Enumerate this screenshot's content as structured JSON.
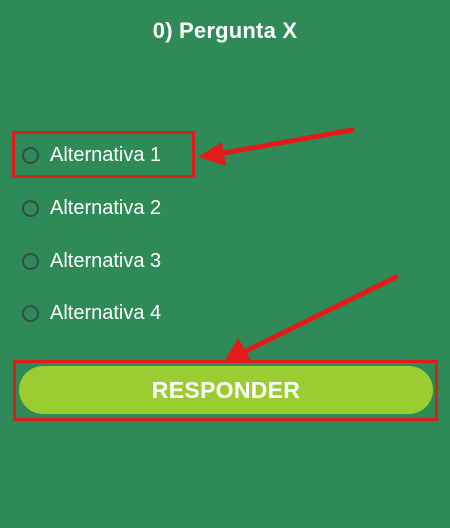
{
  "question": {
    "title": "0) Pergunta X"
  },
  "options": [
    {
      "label": "Alternativa 1"
    },
    {
      "label": "Alternativa 2"
    },
    {
      "label": "Alternativa 3"
    },
    {
      "label": "Alternativa 4"
    }
  ],
  "submit": {
    "label": "RESPONDER"
  },
  "annotations": {
    "color": "#e21b1b",
    "icons": [
      "arrow-icon",
      "arrow-icon"
    ]
  },
  "theme": {
    "background": "#2e8b57",
    "button": "#9acd32"
  }
}
